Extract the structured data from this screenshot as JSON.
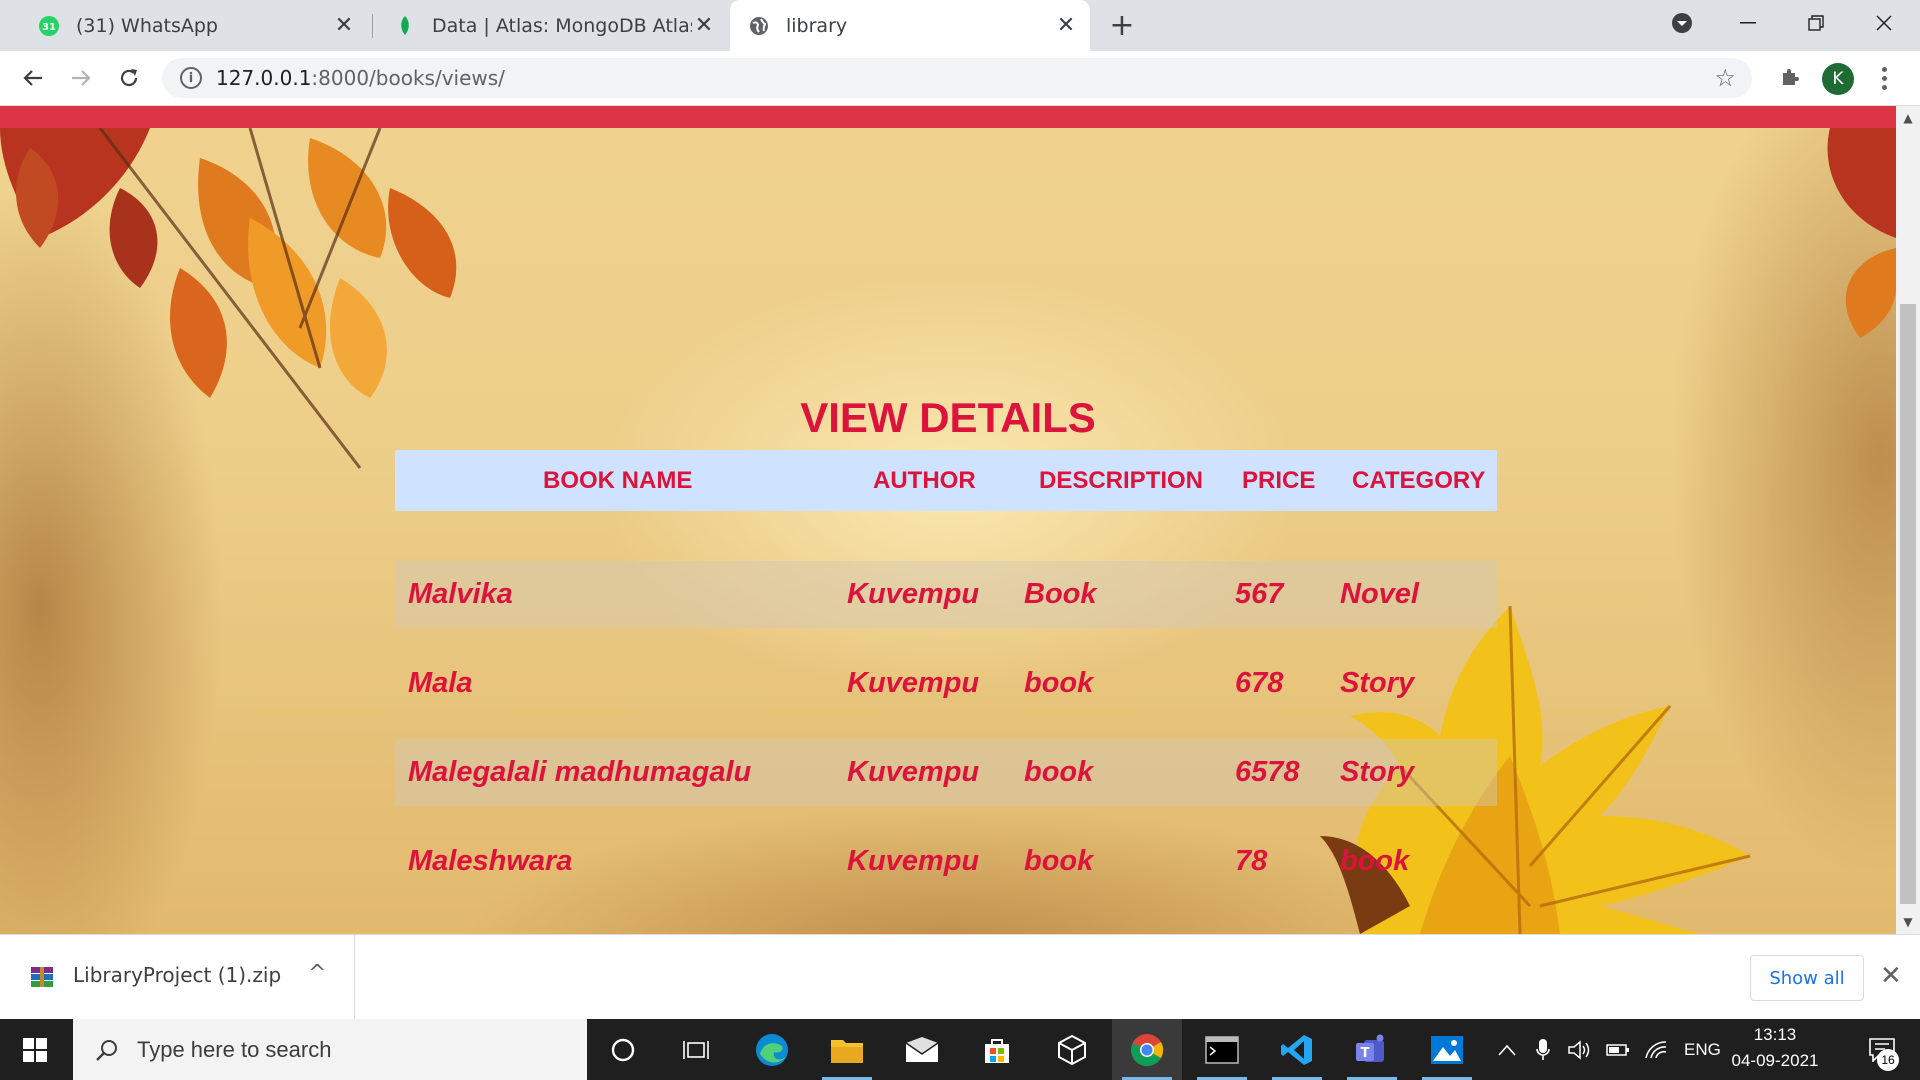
{
  "browser": {
    "tabs": [
      {
        "title": "(31) WhatsApp",
        "icon": "whatsapp-icon",
        "badge": "31"
      },
      {
        "title": "Data | Atlas: MongoDB Atlas",
        "icon": "mongodb-leaf-icon"
      },
      {
        "title": "library",
        "icon": "globe-icon",
        "active": true
      }
    ],
    "url_host": "127.0.0.1",
    "url_path": ":8000/books/views/",
    "profile_initial": "K"
  },
  "page": {
    "accent_color": "#dc143c",
    "header_bar_color": "#dc3545",
    "title": "VIEW DETAILS",
    "table": {
      "headers": [
        "BOOK NAME",
        "AUTHOR",
        "DESCRIPTION",
        "PRICE",
        "CATEGORY"
      ],
      "rows": [
        [
          "Malvika",
          "Kuvempu",
          "Book",
          "567",
          "Novel"
        ],
        [
          "Mala",
          "Kuvempu",
          "book",
          "678",
          "Story"
        ],
        [
          "Malegalali madhumagalu",
          "Kuvempu",
          "book",
          "6578",
          "Story"
        ],
        [
          "Maleshwara",
          "Kuvempu",
          "book",
          "78",
          "book"
        ]
      ]
    }
  },
  "download_bar": {
    "file_name": "LibraryProject (1).zip",
    "show_all_label": "Show all"
  },
  "taskbar": {
    "search_placeholder": "Type here to search",
    "language": "ENG",
    "time": "13:13",
    "date": "04-09-2021",
    "notification_count": "16"
  }
}
